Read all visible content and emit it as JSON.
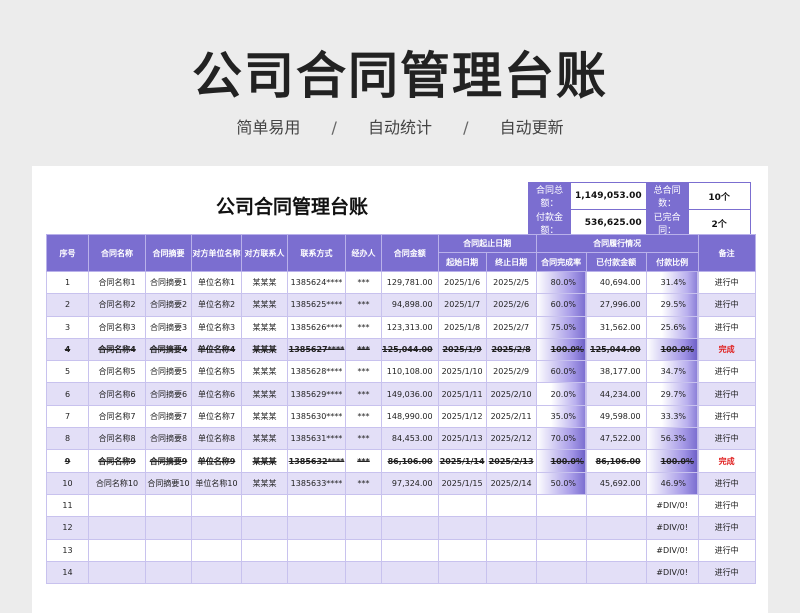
{
  "hero": {
    "title": "公司合同管理台账",
    "features": [
      "简单易用",
      "自动统计",
      "自动更新"
    ],
    "separator": "/"
  },
  "sheet": {
    "title": "公司合同管理台账",
    "summary": {
      "total_amount_label": "合同总额：",
      "total_amount": "1,149,053.00",
      "paid_amount_label": "付款金额：",
      "paid_amount": "536,625.00",
      "total_count_label": "总合同数：",
      "total_count": "10个",
      "completed_label": "已完合同：",
      "completed": "2个"
    },
    "headers": {
      "seq": "序号",
      "name": "合同名称",
      "summary": "合同摘要",
      "party": "对方单位名称",
      "contact": "对方联系人",
      "phone": "联系方式",
      "handler": "经办人",
      "amount": "合同金额",
      "period_group": "合同起止日期",
      "start": "起始日期",
      "end": "终止日期",
      "perf_group": "合同履行情况",
      "completion": "合同完成率",
      "paid": "已付款金额",
      "pay_ratio": "付款比例",
      "remark": "备注"
    },
    "rows": [
      {
        "seq": "1",
        "name": "合同名称1",
        "summary": "合同摘要1",
        "party": "单位名称1",
        "contact": "某某某",
        "phone": "1385624****",
        "handler": "***",
        "amount": "129,781.00",
        "start": "2025/1/6",
        "end": "2025/2/5",
        "completion": "80.0%",
        "paid": "40,694.00",
        "ratio": "31.4%",
        "remark": "进行中",
        "done": false
      },
      {
        "seq": "2",
        "name": "合同名称2",
        "summary": "合同摘要2",
        "party": "单位名称2",
        "contact": "某某某",
        "phone": "1385625****",
        "handler": "***",
        "amount": "94,898.00",
        "start": "2025/1/7",
        "end": "2025/2/6",
        "completion": "60.0%",
        "paid": "27,996.00",
        "ratio": "29.5%",
        "remark": "进行中",
        "done": false
      },
      {
        "seq": "3",
        "name": "合同名称3",
        "summary": "合同摘要3",
        "party": "单位名称3",
        "contact": "某某某",
        "phone": "1385626****",
        "handler": "***",
        "amount": "123,313.00",
        "start": "2025/1/8",
        "end": "2025/2/7",
        "completion": "75.0%",
        "paid": "31,562.00",
        "ratio": "25.6%",
        "remark": "进行中",
        "done": false
      },
      {
        "seq": "4",
        "name": "合同名称4",
        "summary": "合同摘要4",
        "party": "单位名称4",
        "contact": "某某某",
        "phone": "1385627****",
        "handler": "***",
        "amount": "125,044.00",
        "start": "2025/1/9",
        "end": "2025/2/8",
        "completion": "100.0%",
        "paid": "125,044.00",
        "ratio": "100.0%",
        "remark": "完成",
        "done": true
      },
      {
        "seq": "5",
        "name": "合同名称5",
        "summary": "合同摘要5",
        "party": "单位名称5",
        "contact": "某某某",
        "phone": "1385628****",
        "handler": "***",
        "amount": "110,108.00",
        "start": "2025/1/10",
        "end": "2025/2/9",
        "completion": "60.0%",
        "paid": "38,177.00",
        "ratio": "34.7%",
        "remark": "进行中",
        "done": false
      },
      {
        "seq": "6",
        "name": "合同名称6",
        "summary": "合同摘要6",
        "party": "单位名称6",
        "contact": "某某某",
        "phone": "1385629****",
        "handler": "***",
        "amount": "149,036.00",
        "start": "2025/1/11",
        "end": "2025/2/10",
        "completion": "20.0%",
        "paid": "44,234.00",
        "ratio": "29.7%",
        "remark": "进行中",
        "done": false
      },
      {
        "seq": "7",
        "name": "合同名称7",
        "summary": "合同摘要7",
        "party": "单位名称7",
        "contact": "某某某",
        "phone": "1385630****",
        "handler": "***",
        "amount": "148,990.00",
        "start": "2025/1/12",
        "end": "2025/2/11",
        "completion": "35.0%",
        "paid": "49,598.00",
        "ratio": "33.3%",
        "remark": "进行中",
        "done": false
      },
      {
        "seq": "8",
        "name": "合同名称8",
        "summary": "合同摘要8",
        "party": "单位名称8",
        "contact": "某某某",
        "phone": "1385631****",
        "handler": "***",
        "amount": "84,453.00",
        "start": "2025/1/13",
        "end": "2025/2/12",
        "completion": "70.0%",
        "paid": "47,522.00",
        "ratio": "56.3%",
        "remark": "进行中",
        "done": false
      },
      {
        "seq": "9",
        "name": "合同名称9",
        "summary": "合同摘要9",
        "party": "单位名称9",
        "contact": "某某某",
        "phone": "1385632****",
        "handler": "***",
        "amount": "86,106.00",
        "start": "2025/1/14",
        "end": "2025/2/13",
        "completion": "100.0%",
        "paid": "86,106.00",
        "ratio": "100.0%",
        "remark": "完成",
        "done": true
      },
      {
        "seq": "10",
        "name": "合同名称10",
        "summary": "合同摘要10",
        "party": "单位名称10",
        "contact": "某某某",
        "phone": "1385633****",
        "handler": "***",
        "amount": "97,324.00",
        "start": "2025/1/15",
        "end": "2025/2/14",
        "completion": "50.0%",
        "paid": "45,692.00",
        "ratio": "46.9%",
        "remark": "进行中",
        "done": false
      },
      {
        "seq": "11",
        "name": "",
        "summary": "",
        "party": "",
        "contact": "",
        "phone": "",
        "handler": "",
        "amount": "",
        "start": "",
        "end": "",
        "completion": "",
        "paid": "",
        "ratio": "#DIV/0!",
        "remark": "进行中",
        "done": false
      },
      {
        "seq": "12",
        "name": "",
        "summary": "",
        "party": "",
        "contact": "",
        "phone": "",
        "handler": "",
        "amount": "",
        "start": "",
        "end": "",
        "completion": "",
        "paid": "",
        "ratio": "#DIV/0!",
        "remark": "进行中",
        "done": false
      },
      {
        "seq": "13",
        "name": "",
        "summary": "",
        "party": "",
        "contact": "",
        "phone": "",
        "handler": "",
        "amount": "",
        "start": "",
        "end": "",
        "completion": "",
        "paid": "",
        "ratio": "#DIV/0!",
        "remark": "进行中",
        "done": false
      },
      {
        "seq": "14",
        "name": "",
        "summary": "",
        "party": "",
        "contact": "",
        "phone": "",
        "handler": "",
        "amount": "",
        "start": "",
        "end": "",
        "completion": "",
        "paid": "",
        "ratio": "#DIV/0!",
        "remark": "进行中",
        "done": false
      }
    ]
  }
}
